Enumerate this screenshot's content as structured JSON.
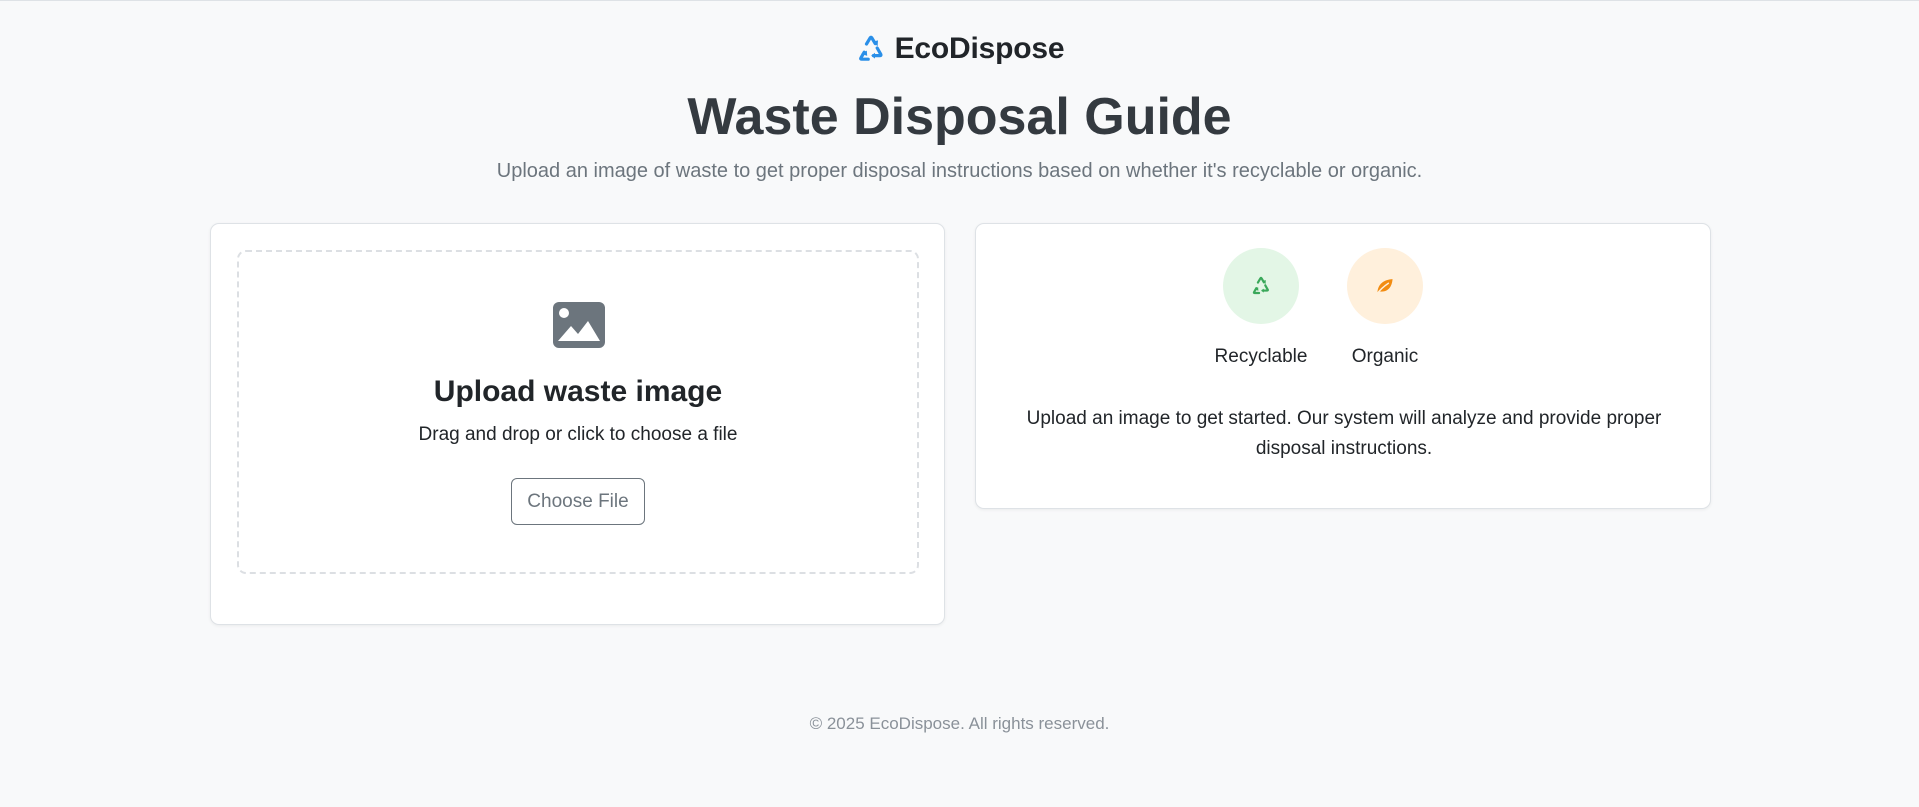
{
  "brand": {
    "name": "EcoDispose",
    "icon": "recycle-icon",
    "accent_color": "#2a8fe8"
  },
  "header": {
    "title": "Waste Disposal Guide",
    "subtitle": "Upload an image of waste to get proper disposal instructions based on whether it's recyclable or organic."
  },
  "upload": {
    "icon": "image-icon",
    "title": "Upload waste image",
    "hint": "Drag and drop or click to choose a file",
    "button_label": "Choose File"
  },
  "categories": [
    {
      "label": "Recyclable",
      "icon": "recycle-icon",
      "color": "#3aa85a",
      "bg": "#e3f6e6"
    },
    {
      "label": "Organic",
      "icon": "leaf-icon",
      "color": "#f28c12",
      "bg": "#fff0dc"
    }
  ],
  "info": {
    "text": "Upload an image to get started. Our system will analyze and provide proper disposal instructions."
  },
  "footer": {
    "text": "© 2025 EcoDispose. All rights reserved."
  }
}
